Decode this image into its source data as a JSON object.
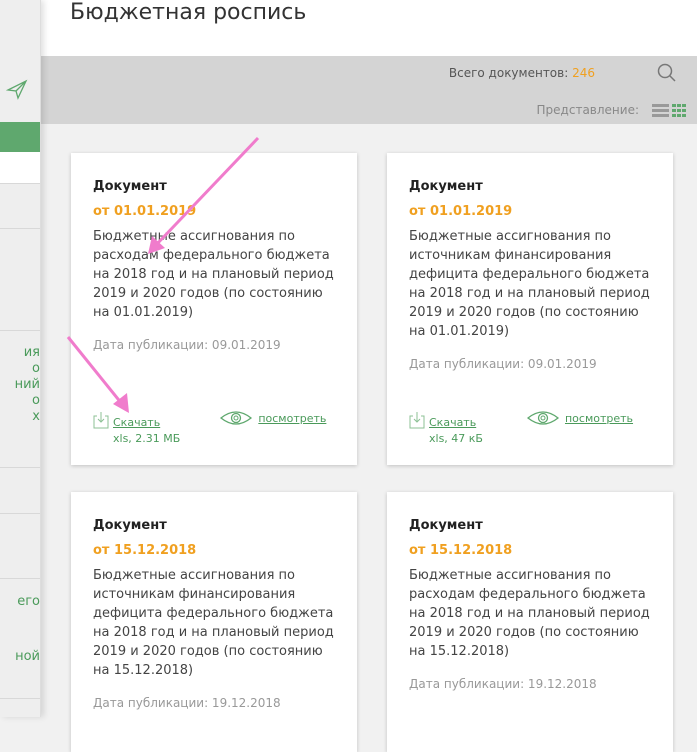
{
  "page": {
    "title": "Бюджетная роспись"
  },
  "toolbar": {
    "count_label": "Всего документов:",
    "count": "246",
    "view_label": "Представление:"
  },
  "sidebar": {
    "fragment1": "ия\nо\nний\n о\nх",
    "fragment2": "его",
    "fragment3": "ной"
  },
  "cards": [
    {
      "type": "Документ",
      "date": "от 01.01.2019",
      "desc": "Бюджетные ассигнования по расходам федерального бюджета на 2018 год и на плановый период 2019 и 2020 годов (по состоянию на 01.01.2019)",
      "pub": "Дата публикации: 09.01.2019",
      "download": "Скачать",
      "size": "xls, 2.31 МБ",
      "view": "посмотреть"
    },
    {
      "type": "Документ",
      "date": "от 01.01.2019",
      "desc": "Бюджетные ассигнования по источникам финансирования дефицита федерального бюджета на 2018 год и на плановый период 2019 и 2020 годов (по состоянию на 01.01.2019)",
      "pub": "Дата публикации: 09.01.2019",
      "download": "Скачать",
      "size": "xls, 47 кБ",
      "view": "посмотреть"
    },
    {
      "type": "Документ",
      "date": "от 15.12.2018",
      "desc": "Бюджетные ассигнования по источникам финансирования дефицита федерального бюджета на 2018 год и на плановый период 2019 и 2020 годов (по состоянию на 15.12.2018)",
      "pub": "Дата публикации: 19.12.2018"
    },
    {
      "type": "Документ",
      "date": "от 15.12.2018",
      "desc": "Бюджетные ассигнования по расходам федерального бюджета на 2018 год и на плановый период 2019 и 2020 годов (по состоянию на 15.12.2018)",
      "pub": "Дата публикации: 19.12.2018"
    }
  ]
}
